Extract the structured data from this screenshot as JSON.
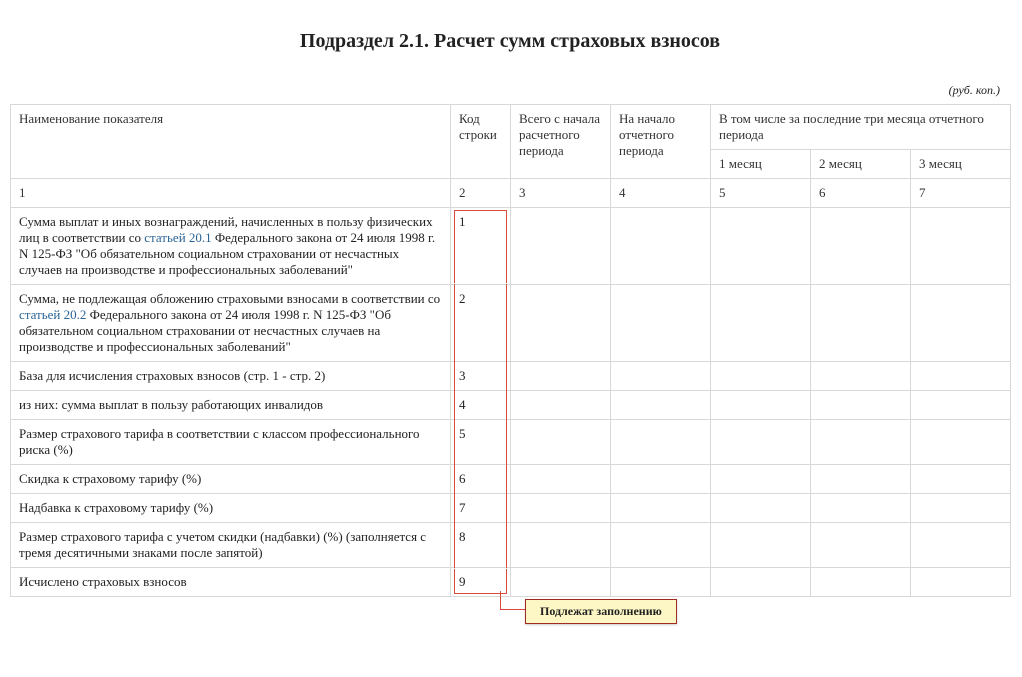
{
  "title": "Подраздел 2.1. Расчет сумм страховых взносов",
  "unit_note": "(руб. коп.)",
  "headers": {
    "name": "Наименование показателя",
    "code": "Код строки",
    "total": "Всего с начала расчетного периода",
    "start": "На начало отчетного периода",
    "three_months_group": "В том числе за последние три месяца отчетного периода",
    "m1": "1 месяц",
    "m2": "2 месяц",
    "m3": "3 месяц"
  },
  "col_numbers": {
    "c1": "1",
    "c2": "2",
    "c3": "3",
    "c4": "4",
    "c5": "5",
    "c6": "6",
    "c7": "7"
  },
  "rows": [
    {
      "name_pre": "Сумма выплат и иных вознаграждений, начисленных в пользу физических лиц в соответствии со ",
      "link": "статьей 20.1",
      "name_post": " Федерального закона от 24 июля 1998 г. N 125-ФЗ \"Об обязательном социальном страховании от несчастных случаев на производстве и профессиональных заболеваний\"",
      "code": "1"
    },
    {
      "name_pre": "Сумма, не подлежащая обложению страховыми взносами в соответствии со ",
      "link": "статьей 20.2",
      "name_post": " Федерального закона от 24 июля 1998 г. N 125-ФЗ \"Об обязательном социальном страховании от несчастных случаев на производстве и профессиональных заболеваний\"",
      "code": "2"
    },
    {
      "name_pre": "База для исчисления страховых взносов (стр. 1 - стр. 2)",
      "link": "",
      "name_post": "",
      "code": "3"
    },
    {
      "name_pre": "из них: сумма выплат в пользу работающих инвалидов",
      "link": "",
      "name_post": "",
      "code": "4"
    },
    {
      "name_pre": "Размер страхового тарифа в соответствии с классом профессионального риска (%)",
      "link": "",
      "name_post": "",
      "code": "5"
    },
    {
      "name_pre": "Скидка к страховому тарифу (%)",
      "link": "",
      "name_post": "",
      "code": "6"
    },
    {
      "name_pre": "Надбавка к страховому тарифу (%)",
      "link": "",
      "name_post": "",
      "code": "7"
    },
    {
      "name_pre": "Размер страхового тарифа с учетом скидки (надбавки) (%) (заполняется с тремя десятичными знаками после запятой)",
      "link": "",
      "name_post": "",
      "code": "8"
    },
    {
      "name_pre": "Исчислено страховых взносов",
      "link": "",
      "name_post": "",
      "code": "9"
    }
  ],
  "callout": "Подлежат заполнению"
}
